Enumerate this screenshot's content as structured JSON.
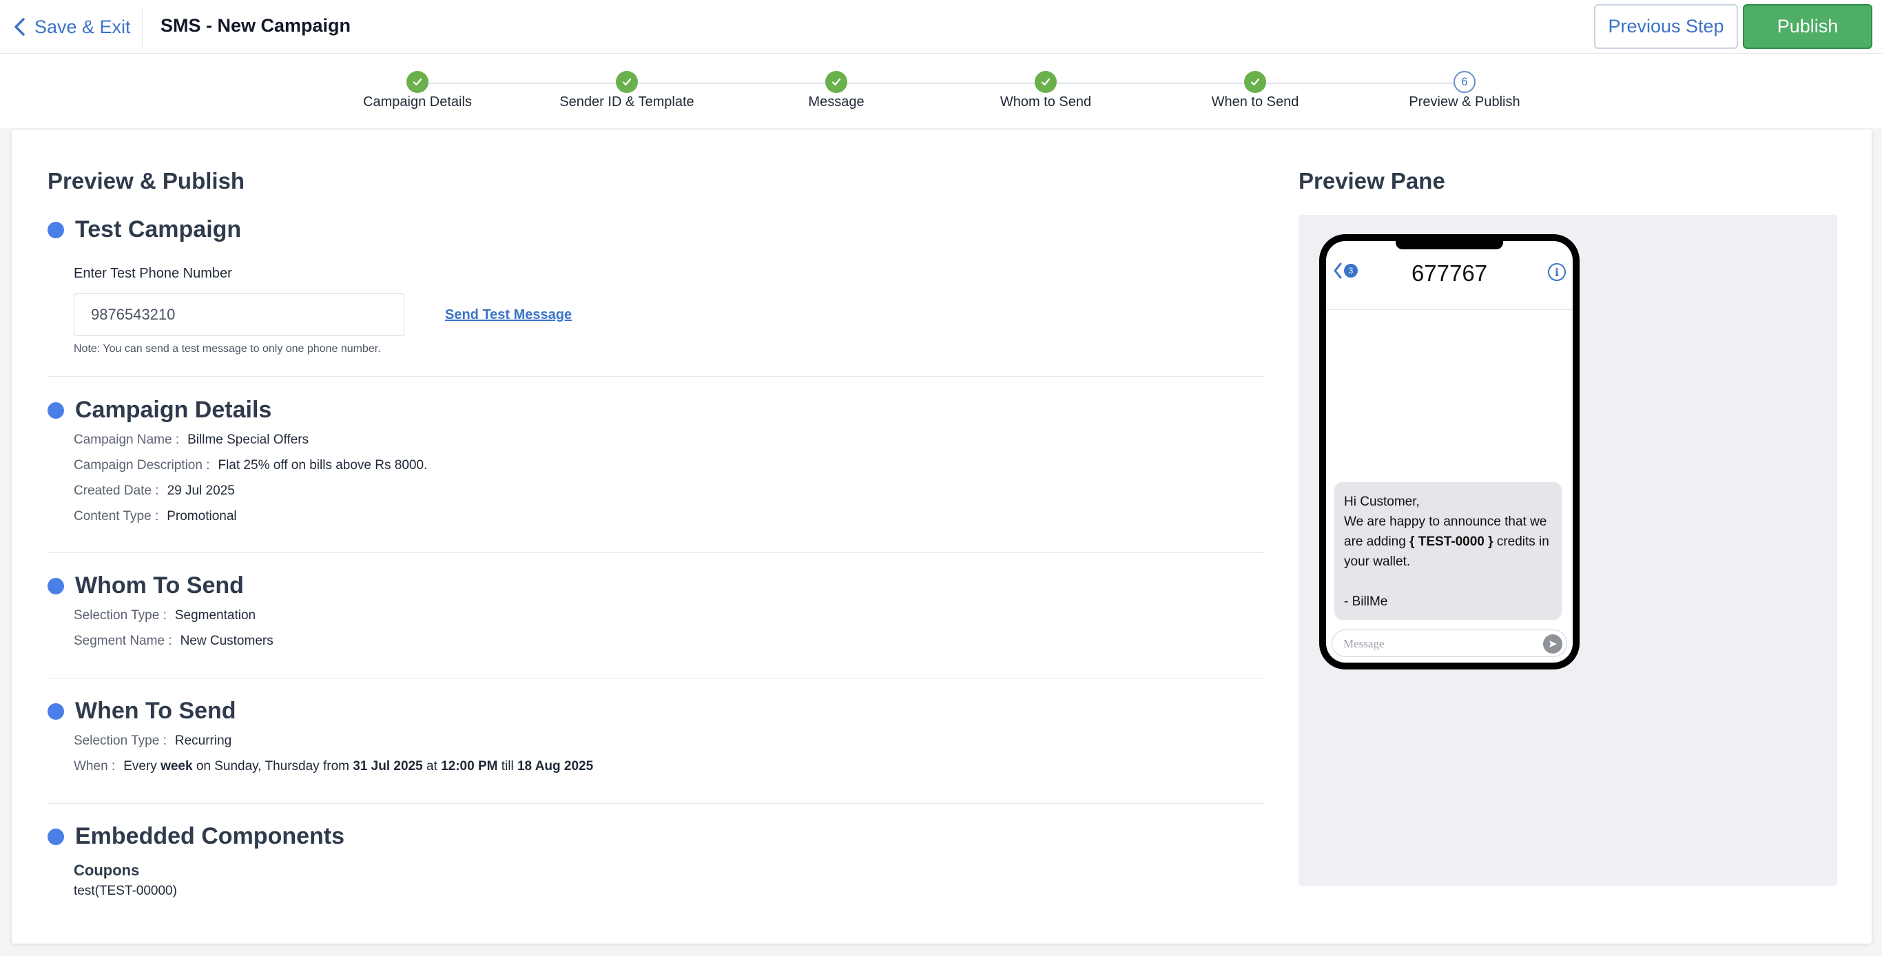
{
  "header": {
    "back_label": "Save & Exit",
    "title": "SMS - New Campaign",
    "prev_label": "Previous Step",
    "publish_label": "Publish"
  },
  "stepper": {
    "steps": [
      {
        "label": "Campaign Details",
        "status": "done"
      },
      {
        "label": "Sender ID & Template",
        "status": "done"
      },
      {
        "label": "Message",
        "status": "done"
      },
      {
        "label": "Whom to Send",
        "status": "done"
      },
      {
        "label": "When to Send",
        "status": "done"
      },
      {
        "label": "Preview & Publish",
        "status": "current",
        "number": "6"
      }
    ]
  },
  "main": {
    "title": "Preview & Publish",
    "test": {
      "title": "Test Campaign",
      "label": "Enter Test Phone Number",
      "phone_value": "9876543210",
      "send_label": "Send Test Message",
      "note": "Note: You can send a test message to only one phone number."
    },
    "details": {
      "title": "Campaign Details",
      "name_key": "Campaign Name :",
      "name_value": "Billme Special Offers",
      "desc_key": "Campaign Description :",
      "desc_value": "Flat 25% off on bills above Rs 8000.",
      "date_key": "Created Date :",
      "date_value": "29 Jul 2025",
      "type_key": "Content Type :",
      "type_value": "Promotional"
    },
    "whom": {
      "title": "Whom To Send",
      "sel_key": "Selection Type :",
      "sel_value": "Segmentation",
      "seg_key": "Segment Name :",
      "seg_value": "New Customers"
    },
    "when": {
      "title": "When To Send",
      "sel_key": "Selection Type :",
      "sel_value": "Recurring",
      "when_key": "When :",
      "w1": "Every",
      "w2": "week",
      "w3": "on Sunday, Thursday from",
      "w4": "31 Jul 2025",
      "w5": "at",
      "w6": "12:00 PM",
      "w7": "till",
      "w8": "18 Aug 2025"
    },
    "embedded": {
      "title": "Embedded Components",
      "coupons_title": "Coupons",
      "coupon_item": "test(TEST-00000)"
    }
  },
  "preview": {
    "title": "Preview Pane",
    "badge": "3",
    "sender": "677767",
    "info": "i",
    "msg_line1": "Hi Customer,",
    "msg_line2a": "We are happy to announce that we are adding",
    "msg_code": "{ TEST-0000 }",
    "msg_line2b": "credits in your wallet.",
    "msg_sign": "- BillMe",
    "input_placeholder": "Message"
  },
  "colors": {
    "accent": "#3b73c8",
    "publish": "#4eae66",
    "step_done": "#6ab04c",
    "bullet": "#4b7fe8"
  }
}
